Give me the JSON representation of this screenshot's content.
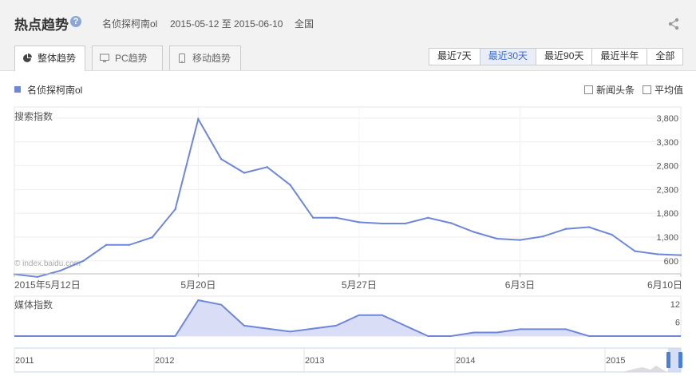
{
  "header": {
    "title": "热点趋势",
    "help_icon": "question-icon",
    "keyword": "名侦探柯南ol",
    "date_range": "2015-05-12 至 2015-06-10",
    "region": "全国",
    "share_icon": "share-icon"
  },
  "tabs": [
    {
      "label": "整体趋势",
      "icon": "pie-icon",
      "active": true
    },
    {
      "label": "PC趋势",
      "icon": "monitor-icon",
      "active": false
    },
    {
      "label": "移动趋势",
      "icon": "mobile-icon",
      "active": false
    }
  ],
  "range_buttons": [
    {
      "label": "最近7天",
      "active": false
    },
    {
      "label": "最近30天",
      "active": true
    },
    {
      "label": "最近90天",
      "active": false
    },
    {
      "label": "最近半年",
      "active": false
    },
    {
      "label": "全部",
      "active": false
    }
  ],
  "legend": {
    "label": "名侦探柯南ol",
    "color": "#6f87d8"
  },
  "checkboxes": [
    {
      "label": "新闻头条",
      "checked": false
    },
    {
      "label": "平均值",
      "checked": false
    }
  ],
  "watermark": "© index.baidu.com",
  "chart_data": [
    {
      "type": "line",
      "title": "搜索指数",
      "series": [
        {
          "name": "名侦探柯南ol",
          "values": [
            290,
            230,
            370,
            590,
            950,
            950,
            1120,
            1750,
            3780,
            2880,
            2570,
            2700,
            2300,
            1560,
            1560,
            1460,
            1430,
            1430,
            1560,
            1440,
            1240,
            1090,
            1060,
            1140,
            1310,
            1350,
            1180,
            810,
            740,
            720
          ]
        }
      ],
      "x_tick_labels": [
        "2015年5月12日",
        "5月20日",
        "5月27日",
        "6月3日",
        "6月10日"
      ],
      "y_ticks": [
        "3,800",
        "3,300",
        "2,800",
        "2,300",
        "1,800",
        "1,300",
        "600"
      ],
      "ylim": [
        300,
        3800
      ],
      "grid": true
    },
    {
      "type": "area",
      "title": "媒体指数",
      "series": [
        {
          "name": "名侦探柯南ol",
          "values": [
            0,
            0,
            0,
            0,
            0,
            0,
            0,
            0,
            12,
            10.5,
            3.5,
            2.5,
            1.5,
            2.5,
            3.5,
            7,
            7,
            3.5,
            0,
            0,
            1.2,
            1.2,
            2.3,
            2.3,
            2.3,
            0,
            0,
            0,
            0,
            0
          ]
        }
      ],
      "y_ticks": [
        "12",
        "6"
      ],
      "ylim": [
        0,
        12
      ]
    },
    {
      "type": "area",
      "title": "",
      "x_tick_labels": [
        "2011",
        "2012",
        "2013",
        "2014",
        "2015"
      ]
    }
  ]
}
